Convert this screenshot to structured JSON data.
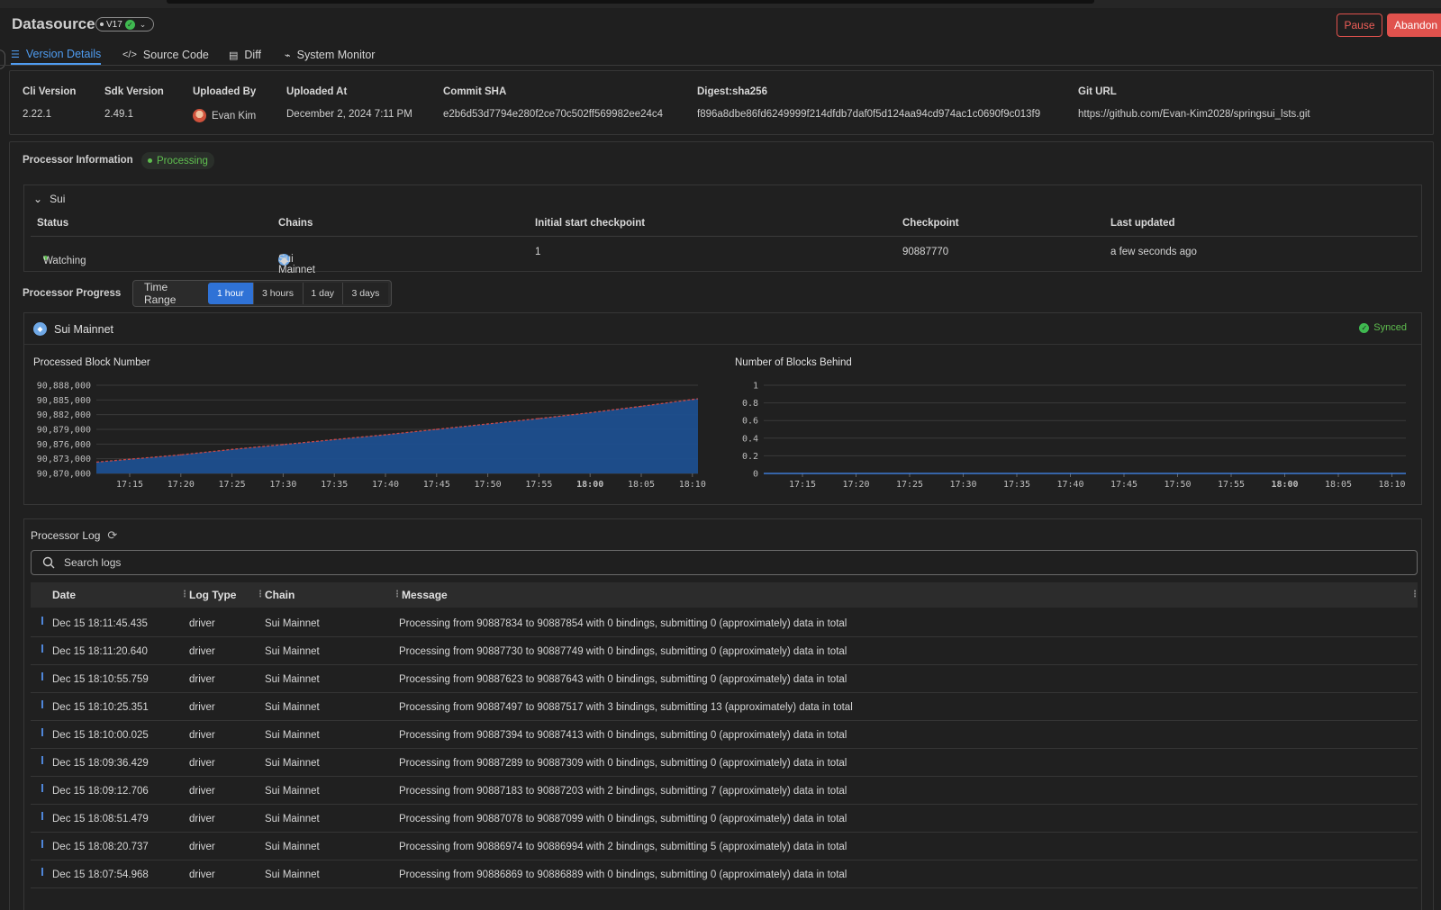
{
  "header": {
    "title": "Datasource",
    "version": "V17",
    "pause_label": "Pause",
    "abandon_label": "Abandon"
  },
  "tabs": [
    {
      "label": "Version Details",
      "icon": "list-icon",
      "active": true
    },
    {
      "label": "Source Code",
      "icon": "code-icon",
      "active": false
    },
    {
      "label": "Diff",
      "icon": "document-icon",
      "active": false
    },
    {
      "label": "System Monitor",
      "icon": "chart-icon",
      "active": false
    }
  ],
  "meta": {
    "cli_version": {
      "label": "Cli Version",
      "value": "2.22.1"
    },
    "sdk_version": {
      "label": "Sdk Version",
      "value": "2.49.1"
    },
    "uploaded_by": {
      "label": "Uploaded By",
      "value": "Evan Kim"
    },
    "uploaded_at": {
      "label": "Uploaded At",
      "value": "December 2, 2024 7:11 PM"
    },
    "commit_sha": {
      "label": "Commit SHA",
      "value": "e2b6d53d7794e280f2ce70c502ff569982ee24c4"
    },
    "digest": {
      "label": "Digest:sha256",
      "value": "f896a8dbe86fd6249999f214dfdb7daf0f5d124aa94cd974ac1c0690f9c013f9"
    },
    "git_url": {
      "label": "Git URL",
      "value": "https://github.com/Evan-Kim2028/springsui_lsts.git"
    }
  },
  "processor": {
    "section_label": "Processor Information",
    "status": "Processing",
    "group_name": "Sui",
    "columns": [
      "Status",
      "Chains",
      "Initial start checkpoint",
      "Checkpoint",
      "Last updated"
    ],
    "row": {
      "status": "Watching",
      "chain": "Sui Mainnet",
      "initial_checkpoint": "1",
      "checkpoint": "90887770",
      "last_updated": "a few seconds ago"
    }
  },
  "progress": {
    "section_label": "Processor Progress",
    "time_range_label": "Time Range",
    "ranges": [
      "1 hour",
      "3 hours",
      "1 day",
      "3 days"
    ],
    "active_range": "1 hour",
    "chain_name": "Sui Mainnet",
    "sync_status": "Synced"
  },
  "chart_data": [
    {
      "type": "area",
      "title": "Processed Block Number",
      "x": [
        "17:15",
        "17:20",
        "17:25",
        "17:30",
        "17:35",
        "17:40",
        "17:45",
        "17:50",
        "17:55",
        "18:00",
        "18:05",
        "18:10"
      ],
      "series": [
        {
          "values": [
            90872900,
            90873800,
            90874900,
            90875900,
            90876900,
            90877900,
            90879000,
            90880100,
            90881200,
            90882400,
            90883700,
            90885100
          ]
        }
      ],
      "yticks": [
        "90,888,000",
        "90,885,000",
        "90,882,000",
        "90,879,000",
        "90,876,000",
        "90,873,000",
        "90,870,000"
      ],
      "ylim": [
        90870000,
        90888000
      ],
      "colors": {
        "fill": "#1e4f8f",
        "line": "#c44a4a"
      }
    },
    {
      "type": "line",
      "title": "Number of Blocks Behind",
      "x": [
        "17:15",
        "17:20",
        "17:25",
        "17:30",
        "17:35",
        "17:40",
        "17:45",
        "17:50",
        "17:55",
        "18:00",
        "18:05",
        "18:10"
      ],
      "series": [
        {
          "values": [
            0,
            0,
            0,
            0,
            0,
            0,
            0,
            0,
            0,
            0,
            0,
            0
          ]
        }
      ],
      "yticks": [
        "1",
        "0.8",
        "0.6",
        "0.4",
        "0.2",
        "0"
      ],
      "ylim": [
        0,
        1
      ],
      "colors": {
        "line": "#3d7ad6"
      }
    }
  ],
  "log": {
    "title": "Processor Log",
    "search_placeholder": "Search logs",
    "columns": [
      "Date",
      "Log Type",
      "Chain",
      "Message"
    ],
    "rows": [
      {
        "date": "Dec 15 18:11:45.435",
        "type": "driver",
        "chain": "Sui Mainnet",
        "message": "Processing from 90887834 to 90887854 with 0 bindings, submitting 0 (approximately) data in total"
      },
      {
        "date": "Dec 15 18:11:20.640",
        "type": "driver",
        "chain": "Sui Mainnet",
        "message": "Processing from 90887730 to 90887749 with 0 bindings, submitting 0 (approximately) data in total"
      },
      {
        "date": "Dec 15 18:10:55.759",
        "type": "driver",
        "chain": "Sui Mainnet",
        "message": "Processing from 90887623 to 90887643 with 0 bindings, submitting 0 (approximately) data in total"
      },
      {
        "date": "Dec 15 18:10:25.351",
        "type": "driver",
        "chain": "Sui Mainnet",
        "message": "Processing from 90887497 to 90887517 with 3 bindings, submitting 13 (approximately) data in total"
      },
      {
        "date": "Dec 15 18:10:00.025",
        "type": "driver",
        "chain": "Sui Mainnet",
        "message": "Processing from 90887394 to 90887413 with 0 bindings, submitting 0 (approximately) data in total"
      },
      {
        "date": "Dec 15 18:09:36.429",
        "type": "driver",
        "chain": "Sui Mainnet",
        "message": "Processing from 90887289 to 90887309 with 0 bindings, submitting 0 (approximately) data in total"
      },
      {
        "date": "Dec 15 18:09:12.706",
        "type": "driver",
        "chain": "Sui Mainnet",
        "message": "Processing from 90887183 to 90887203 with 2 bindings, submitting 7 (approximately) data in total"
      },
      {
        "date": "Dec 15 18:08:51.479",
        "type": "driver",
        "chain": "Sui Mainnet",
        "message": "Processing from 90887078 to 90887099 with 0 bindings, submitting 0 (approximately) data in total"
      },
      {
        "date": "Dec 15 18:08:20.737",
        "type": "driver",
        "chain": "Sui Mainnet",
        "message": "Processing from 90886974 to 90886994 with 2 bindings, submitting 5 (approximately) data in total"
      },
      {
        "date": "Dec 15 18:07:54.968",
        "type": "driver",
        "chain": "Sui Mainnet",
        "message": "Processing from 90886869 to 90886889 with 0 bindings, submitting 0 (approximately) data in total"
      }
    ]
  }
}
